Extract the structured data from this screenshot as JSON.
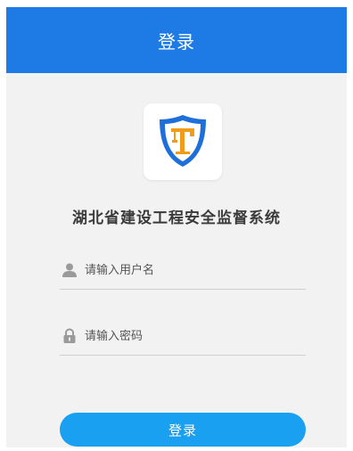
{
  "header": {
    "title": "登录"
  },
  "logo": {
    "icon": "shield-crane-icon"
  },
  "app": {
    "title": "湖北省建设工程安全监督系统"
  },
  "form": {
    "username": {
      "icon": "user-icon",
      "placeholder": "请输入用户名",
      "value": ""
    },
    "password": {
      "icon": "lock-icon",
      "placeholder": "请输入密码",
      "value": ""
    },
    "submit_label": "登录"
  },
  "colors": {
    "header_bg": "#1e7be6",
    "button_bg": "#1aa0f0",
    "page_bg": "#f2f2f2",
    "shield_blue": "#1e6fd9",
    "crane_orange": "#f29a1a"
  }
}
